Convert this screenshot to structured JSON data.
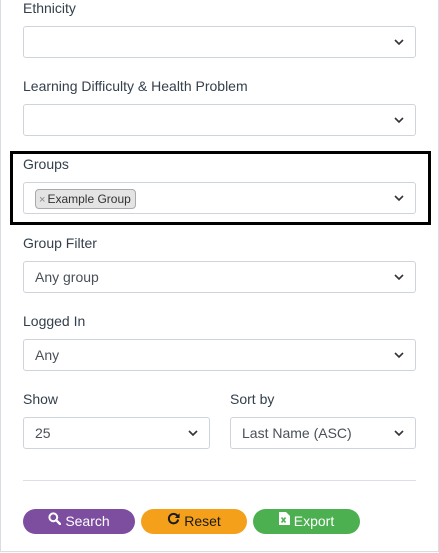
{
  "filters": {
    "ethnicity": {
      "label": "Ethnicity",
      "value": ""
    },
    "learning": {
      "label": "Learning Difficulty & Health Problem",
      "value": ""
    },
    "groups": {
      "label": "Groups",
      "tags": [
        "Example Group"
      ],
      "remove_glyph": "×"
    },
    "group_filter": {
      "label": "Group Filter",
      "value": "Any group"
    },
    "logged_in": {
      "label": "Logged In",
      "value": "Any"
    },
    "show": {
      "label": "Show",
      "value": "25"
    },
    "sort_by": {
      "label": "Sort by",
      "value": "Last Name (ASC)"
    }
  },
  "buttons": {
    "search": "Search",
    "reset": "Reset",
    "export": "Export"
  },
  "colors": {
    "search_button": "#7d4e9f",
    "reset_button": "#f5a01a",
    "export_button": "#4caf50"
  }
}
